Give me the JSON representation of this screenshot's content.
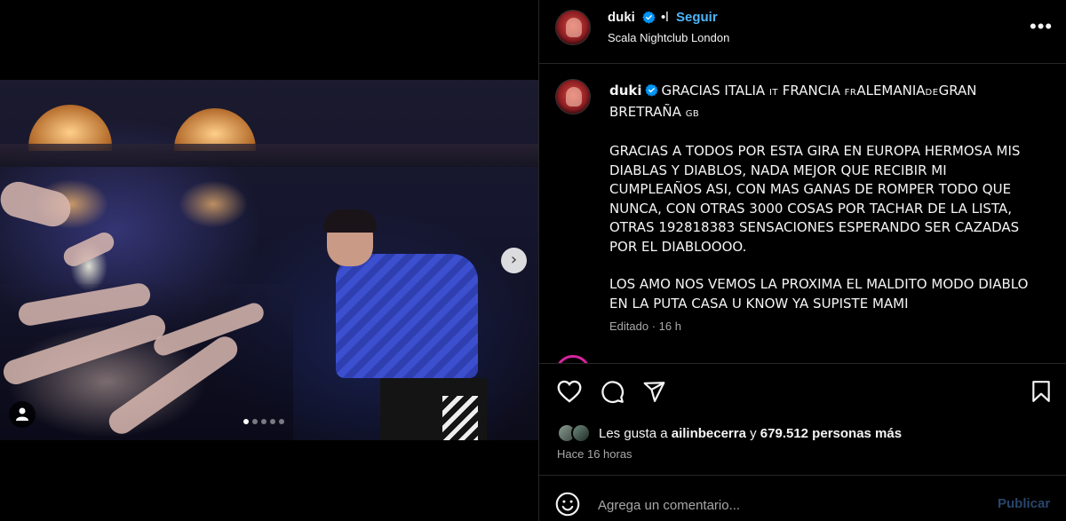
{
  "post": {
    "username": "duki",
    "separator": "•l",
    "follow_label": "Seguir",
    "location": "Scala Nightclub London",
    "more_label": "•••"
  },
  "media": {
    "next_glyph": "›",
    "carousel_count": 5,
    "carousel_active": 1
  },
  "caption": {
    "line1_a": "GRACIAS ITALIA ",
    "flag_it": "IT",
    "line1_b": " FRANCIA ",
    "flag_fr": "FR",
    "line1_c": "ALEMANIA",
    "flag_de": "DE",
    "line1_d": "GRAN BRETRAÑA ",
    "flag_gb": "GB",
    "para2": "GRACIAS A TODOS POR ESTA GIRA EN EUROPA HERMOSA MIS DIABLAS Y DIABLOS, NADA MEJOR QUE RECIBIR MI CUMPLEAÑOS ASI, CON MAS GANAS DE ROMPER TODO QUE NUNCA, CON OTRAS 3000 COSAS POR TACHAR DE LA LISTA, OTRAS 192818383 SENSACIONES ESPERANDO SER CAZADAS POR EL DIABLOOOO.",
    "para3": "LOS AMO NOS VEMOS LA PROXIMA EL MALDITO MODO DIABLO EN LA PUTA CASA U KNOW YA SUPISTE MAMI",
    "edited": "Editado · 16 h"
  },
  "engagement": {
    "likes_prefix": "Les gusta a ",
    "liked_by": "ailinbecerra",
    "likes_mid": " y ",
    "likes_count": "679.512 personas más",
    "time": "Hace 16 horas"
  },
  "comment": {
    "placeholder": "Agrega un comentario...",
    "publish_label": "Publicar"
  },
  "colors": {
    "accent_blue": "#4cb5f9",
    "publish_disabled": "#28456b",
    "muted": "#a8a8a8"
  },
  "icons": [
    "verified-badge-icon",
    "more-icon",
    "heart-icon",
    "comment-icon",
    "share-icon",
    "bookmark-icon",
    "emoji-icon",
    "user-tag-icon",
    "chevron-right-icon"
  ]
}
